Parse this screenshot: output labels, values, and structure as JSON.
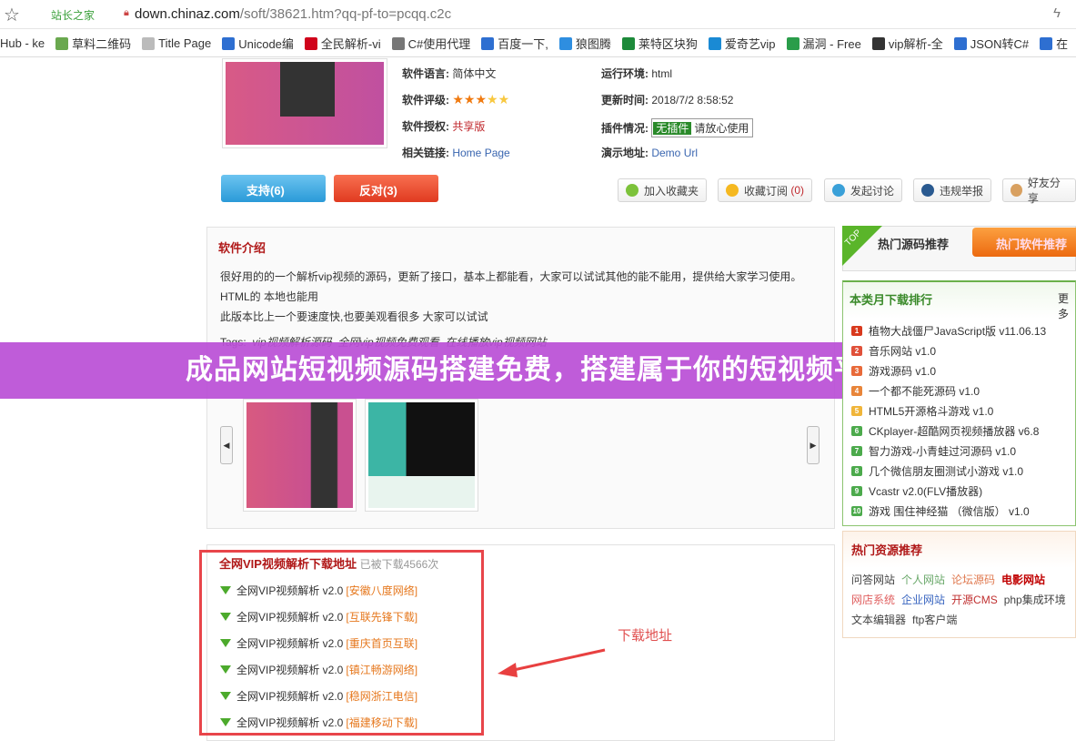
{
  "browser": {
    "site_badge": "站长之家",
    "url_host": "down.chinaz.com",
    "url_path": "/soft/38621.htm?qq-pf-to=pcqq.c2c",
    "bookmarks": [
      {
        "label": "Hub - ke",
        "color": "#333"
      },
      {
        "label": "草料二维码",
        "color": "#6aa84f"
      },
      {
        "label": "Title Page",
        "color": "#bbb"
      },
      {
        "label": "Unicode编",
        "color": "#2e6fd1"
      },
      {
        "label": "全民解析-vi",
        "color": "#d0021b"
      },
      {
        "label": "C#使用代理",
        "color": "#777"
      },
      {
        "label": "百度一下,",
        "color": "#2e6fd1"
      },
      {
        "label": "狼图腾",
        "color": "#2e8ee0"
      },
      {
        "label": "莱特区块狗",
        "color": "#1d8a3a"
      },
      {
        "label": "爱奇艺vip",
        "color": "#1a8ad4"
      },
      {
        "label": "漏洞 - Free",
        "color": "#2a9d4a"
      },
      {
        "label": "vip解析-全",
        "color": "#333"
      },
      {
        "label": "JSON转C#",
        "color": "#2e6fd1"
      },
      {
        "label": "在",
        "color": "#2e6fd1"
      }
    ]
  },
  "info": {
    "lang_label": "软件语言:",
    "lang": "简体中文",
    "env_label": "运行环境:",
    "env": "html",
    "rating_label": "软件评级:",
    "rating": 3,
    "rating_max": 5,
    "update_label": "更新时间:",
    "update": "2018/7/2 8:58:52",
    "license_label": "软件授权:",
    "license": "共享版",
    "plugin_label": "插件情况:",
    "plugin_badge": "无插件",
    "plugin_note": "请放心使用",
    "links_label": "相关链接:",
    "home": "Home Page",
    "demo_label": "演示地址:",
    "demo": "Demo Url"
  },
  "vote": {
    "support": "支持(6)",
    "oppose": "反对(3)"
  },
  "actions": [
    "加入收藏夹",
    "收藏订阅",
    "(0)",
    "发起讨论",
    "违规举报",
    "好友分享"
  ],
  "intro": {
    "title": "软件介绍",
    "lines": [
      "很好用的的一个解析vip视频的源码，更新了接口，基本上都能看，大家可以试试其他的能不能用，提供给大家学习使用。",
      "HTML的 本地也能用",
      "此版本比上一个要速度快,也要美观看很多   大家可以试试"
    ],
    "tags_label": "Tags:",
    "tags": [
      "vip视频解析源码",
      "全网vip视频免费观看",
      "在线播放vip视频网站"
    ]
  },
  "banner": "成品网站短视频源码搭建免费，搭建属于你的短视频平台",
  "download": {
    "title": "全网VIP视频解析下载地址",
    "count": "已被下载4566次",
    "items": [
      {
        "name": "全网VIP视频解析 v2.0",
        "src": "[安徽八度网络]"
      },
      {
        "name": "全网VIP视频解析 v2.0",
        "src": "[互联先锋下载]"
      },
      {
        "name": "全网VIP视频解析 v2.0",
        "src": "[重庆首页互联]"
      },
      {
        "name": "全网VIP视频解析 v2.0",
        "src": "[镇江畅游网络]"
      },
      {
        "name": "全网VIP视频解析 v2.0",
        "src": "[稳网浙江电信]"
      },
      {
        "name": "全网VIP视频解析 v2.0",
        "src": "[福建移动下载]"
      }
    ],
    "annotation": "下载地址"
  },
  "side": {
    "top": "TOP",
    "tab1": "热门源码推荐",
    "tab2": "热门软件推荐",
    "rank_title": "本类月下载排行",
    "more": "更多",
    "rank": [
      {
        "n": "1",
        "t": "植物大战僵尸JavaScript版 v11.06.13",
        "c": "#d8391d"
      },
      {
        "n": "2",
        "t": "音乐网站 v1.0",
        "c": "#e0513a"
      },
      {
        "n": "3",
        "t": "游戏源码 v1.0",
        "c": "#e86a3a"
      },
      {
        "n": "4",
        "t": "一个都不能死源码 v1.0",
        "c": "#e8853a"
      },
      {
        "n": "5",
        "t": "HTML5开源格斗游戏 v1.0",
        "c": "#f0b53a"
      },
      {
        "n": "6",
        "t": "CKplayer-超酷网页视频播放器 v6.8",
        "c": "#4caa4c"
      },
      {
        "n": "7",
        "t": "智力游戏-小青蛙过河源码 v1.0",
        "c": "#4caa4c"
      },
      {
        "n": "8",
        "t": "几个微信朋友圈测试小游戏 v1.0",
        "c": "#4caa4c"
      },
      {
        "n": "9",
        "t": "Vcastr v2.0(FLV播放器)",
        "c": "#4caa4c"
      },
      {
        "n": "10",
        "t": "游戏 围住神经猫 （微信版） v1.0",
        "c": "#4caa4c"
      }
    ],
    "res_title": "热门资源推荐",
    "res": [
      [
        {
          "t": "问答网站",
          "c": "#444"
        },
        {
          "t": "个人网站",
          "c": "#6aa86a"
        },
        {
          "t": "论坛源码",
          "c": "#e07a50"
        },
        {
          "t": "电影网站",
          "c": "#c00000"
        }
      ],
      [
        {
          "t": "网店系统",
          "c": "#e06060"
        },
        {
          "t": "企业网站",
          "c": "#3a66c0"
        },
        {
          "t": "开源CMS",
          "c": "#c03030"
        },
        {
          "t": "php集成环境",
          "c": "#444"
        }
      ],
      [
        {
          "t": "文本编辑器",
          "c": "#444"
        },
        {
          "t": "ftp客户端",
          "c": "#444"
        }
      ]
    ]
  }
}
